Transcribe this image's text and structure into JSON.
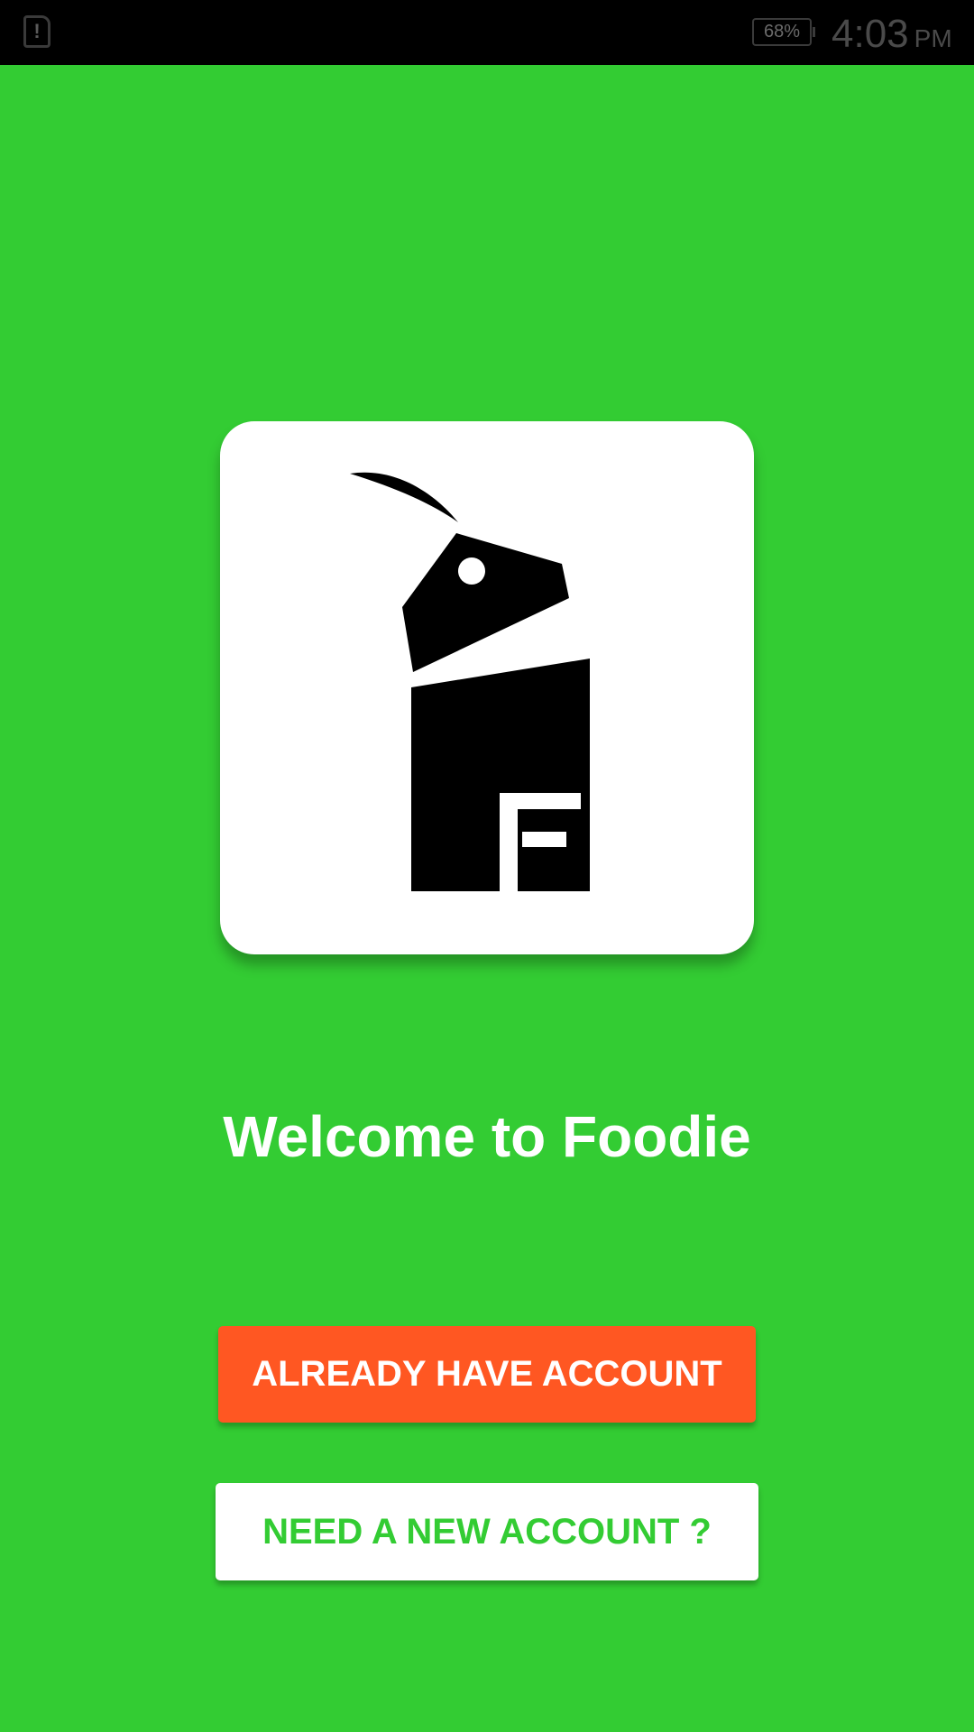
{
  "status_bar": {
    "alert_icon": "sim-alert-icon",
    "battery_level": "68%",
    "time": "4:03",
    "ampm": "PM"
  },
  "logo": {
    "icon": "foodie-goat-logo",
    "background": "#FFFFFF"
  },
  "welcome": {
    "title": "Welcome to Foodie"
  },
  "buttons": {
    "login_label": "ALREADY HAVE ACCOUNT",
    "signup_label": "NEED A NEW ACCOUNT ?"
  },
  "colors": {
    "background": "#33CC33",
    "login_button": "#FF5722",
    "signup_text": "#33CC33",
    "status_bar": "#000000"
  }
}
